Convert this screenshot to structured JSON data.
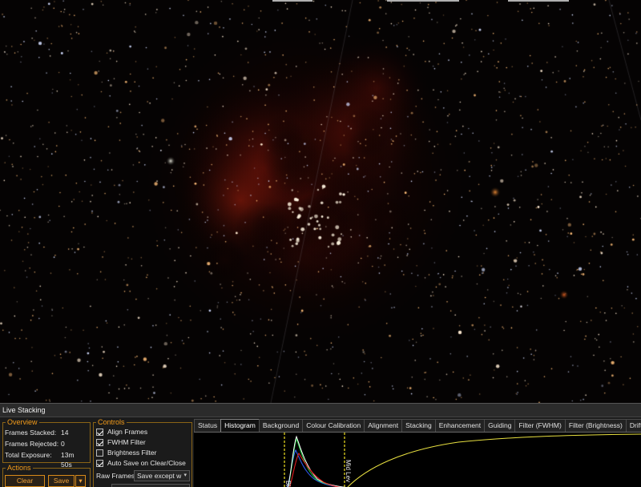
{
  "panel": {
    "title": "Live Stacking"
  },
  "overview": {
    "legend": "Overview",
    "rows": [
      {
        "label": "Frames Stacked:",
        "value": "14"
      },
      {
        "label": "Frames Rejected:",
        "value": "0"
      },
      {
        "label": "Total Exposure:",
        "value": "13m 50s"
      }
    ]
  },
  "actions": {
    "legend": "Actions",
    "clear_label": "Clear",
    "save_label": "Save",
    "dropdown_glyph": "▾"
  },
  "controls": {
    "legend": "Controls",
    "checkboxes": [
      {
        "label": "Align Frames",
        "checked": true
      },
      {
        "label": "FWHM Filter",
        "checked": true
      },
      {
        "label": "Brightness Filter",
        "checked": false
      },
      {
        "label": "Auto Save on Clear/Close",
        "checked": true
      }
    ],
    "raw_frames_label": "Raw Frames",
    "raw_frames_value": "Save except w",
    "dropdown_glyph": "▾"
  },
  "tabs": [
    {
      "label": "Status",
      "active": false
    },
    {
      "label": "Histogram",
      "active": true
    },
    {
      "label": "Background",
      "active": false
    },
    {
      "label": "Colour Calibration",
      "active": false
    },
    {
      "label": "Alignment",
      "active": false
    },
    {
      "label": "Stacking",
      "active": false
    },
    {
      "label": "Enhancement",
      "active": false
    },
    {
      "label": "Guiding",
      "active": false
    },
    {
      "label": "Filter (FWHM)",
      "active": false
    },
    {
      "label": "Filter (Brightness)",
      "active": false
    },
    {
      "label": "Drift Graph",
      "active": false
    }
  ],
  "histogram": {
    "black_label": "Bl",
    "mid_label": "Mid Lev",
    "colors": {
      "red": "#e02020",
      "green": "#20d040",
      "blue": "#3060ff",
      "lum": "#ffffff",
      "curve": "#e8e040",
      "marker": "#f0e020"
    }
  },
  "theme": {
    "accent": "#f29b1a",
    "panel_bg": "#1b1b1b"
  }
}
